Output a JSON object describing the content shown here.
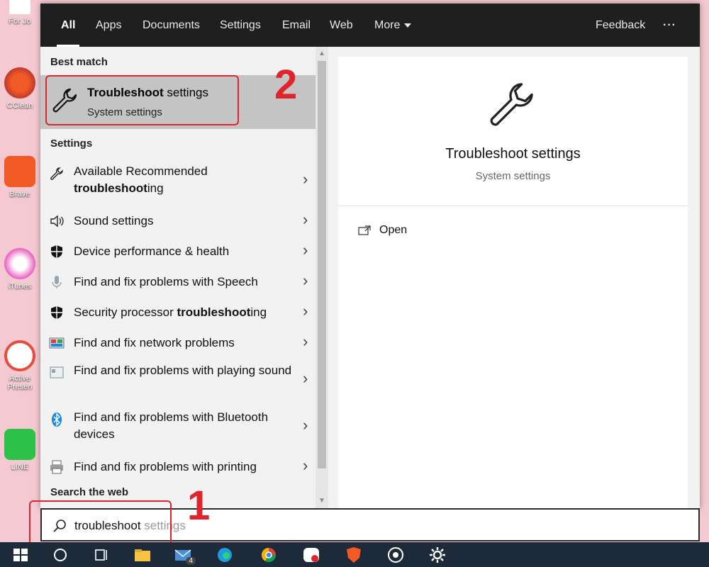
{
  "tabs": [
    {
      "label": "All",
      "active": true
    },
    {
      "label": "Apps"
    },
    {
      "label": "Documents"
    },
    {
      "label": "Settings"
    },
    {
      "label": "Email"
    },
    {
      "label": "Web"
    },
    {
      "label": "More"
    }
  ],
  "feedback_label": "Feedback",
  "more_options": "···",
  "best_match": {
    "heading": "Best match",
    "title_bold": "Troubleshoot",
    "title_rest": " settings",
    "subtitle": "System settings",
    "icon": "wrench-icon"
  },
  "settings_heading": "Settings",
  "settings_items": [
    {
      "pre": "Available Recommended ",
      "bold": "troubleshoot",
      "post": "ing",
      "line2": true,
      "icon": "wrench-icon"
    },
    {
      "pre": "Sound settings",
      "bold": "",
      "post": "",
      "icon": "speaker-icon"
    },
    {
      "pre": "Device performance & health",
      "bold": "",
      "post": "",
      "icon": "shield-icon"
    },
    {
      "pre": "Find and fix problems with Speech",
      "bold": "",
      "post": "",
      "icon": "microphone-icon"
    },
    {
      "pre": "Security processor ",
      "bold": "troubleshoot",
      "post": "ing",
      "icon": "shield-icon"
    },
    {
      "pre": "Find and fix network problems",
      "bold": "",
      "post": "",
      "icon": "network-icon"
    },
    {
      "pre": "Find and fix problems with playing sound",
      "bold": "",
      "post": "",
      "icon": "audio-window-icon"
    },
    {
      "pre": "Find and fix problems with Bluetooth devices",
      "bold": "",
      "post": "",
      "icon": "bluetooth-icon"
    },
    {
      "pre": "Find and fix problems with printing",
      "bold": "",
      "post": "",
      "icon": "printer-icon"
    }
  ],
  "web_heading": "Search the web",
  "detail": {
    "title": "Troubleshoot settings",
    "subtitle": "System settings",
    "open_label": "Open"
  },
  "search": {
    "typed": "troubleshoot",
    "suggestion": " settings"
  },
  "annotations": {
    "step1": "1",
    "step2": "2"
  },
  "desktop_icons": [
    "For Jo",
    "CClean",
    "Brave",
    "iTunes",
    "Active Presen",
    "LINE"
  ],
  "mail_badge": "4",
  "colors": {
    "accent_red": "#e0242e",
    "tab_bar": "#1f1f1f",
    "highlight": "#c4c4c4",
    "taskbar": "#1d2a3a"
  }
}
